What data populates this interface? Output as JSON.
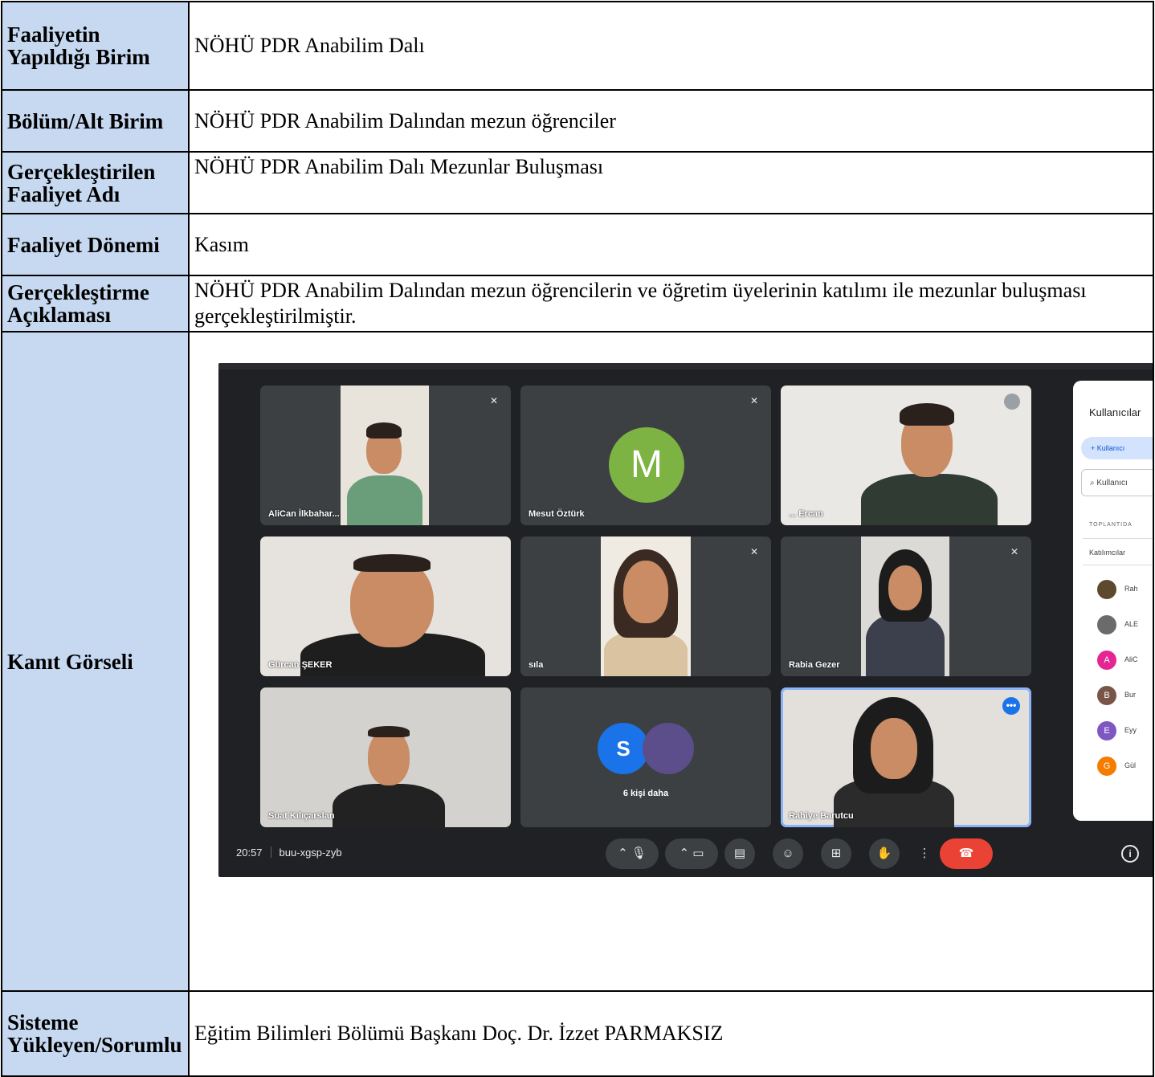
{
  "rows": [
    {
      "label": "Faaliyetin Yapıldığı Birim",
      "value": "NÖHÜ PDR Anabilim Dalı"
    },
    {
      "label": "Bölüm/Alt Birim",
      "value": "NÖHÜ PDR Anabilim Dalından mezun öğrenciler"
    },
    {
      "label": "Gerçekleştirilen Faaliyet Adı",
      "value": "NÖHÜ PDR Anabilim Dalı Mezunlar Buluşması"
    },
    {
      "label": "Faaliyet Dönemi",
      "value": "Kasım"
    },
    {
      "label": "Gerçekleştirme Açıklaması",
      "value": "NÖHÜ PDR Anabilim Dalından mezun öğrencilerin ve öğretim üyelerinin katılımı ile mezunlar buluşması gerçekleştirilmiştir."
    },
    {
      "label": "Kanıt Görseli"
    },
    {
      "label": "Sisteme Yükleyen/Sorumlu",
      "value": "Eğitim Bilimleri Bölümü Başkanı Doç. Dr. İzzet PARMAKSIZ"
    }
  ],
  "meet": {
    "participants": [
      {
        "name": "AliCan İlkbahar..."
      },
      {
        "name": "Mesut Öztürk",
        "initial": "M"
      },
      {
        "name": "... Ercan"
      },
      {
        "name": "Gürcan ŞEKER"
      },
      {
        "name": "sıla"
      },
      {
        "name": "Rabia Gezer"
      },
      {
        "name": "Suat Kılıçarslan"
      },
      {
        "others_initial": "S",
        "others_label": "6 kişi daha"
      },
      {
        "name": "Rahiye Barutcu"
      }
    ],
    "time": "20:57",
    "meeting_code": "buu-xgsp-zyb",
    "panel": {
      "title": "Kullanıcılar",
      "add_button": "Kullanıcı",
      "search_placeholder": "Kullanıcı",
      "section": "TOPLANTIDA",
      "group": "Katılımcılar",
      "people": [
        {
          "initial": "",
          "name": "Rah",
          "color": "#5d4a2e"
        },
        {
          "initial": "",
          "name": "ALE",
          "color": "#6b6b6b"
        },
        {
          "initial": "A",
          "name": "AliC",
          "color": "#e52592"
        },
        {
          "initial": "B",
          "name": "Bur",
          "color": "#795548"
        },
        {
          "initial": "E",
          "name": "Eyy",
          "color": "#7e57c2"
        },
        {
          "initial": "G",
          "name": "Gül",
          "color": "#f57c00"
        }
      ]
    }
  }
}
